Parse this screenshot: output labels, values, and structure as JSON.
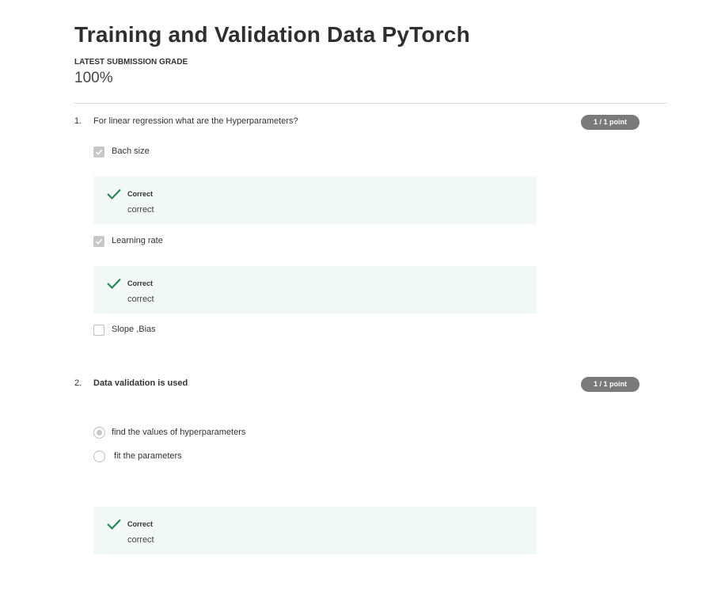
{
  "quiz": {
    "title": "Training and Validation Data PyTorch",
    "grade_label": "LATEST SUBMISSION GRADE",
    "grade_value": "100%"
  },
  "questions": [
    {
      "number": "1.",
      "text": "For linear regression what are the Hyperparameters?",
      "points": "1 / 1 point",
      "options": [
        {
          "label": "Bach size",
          "checked": true,
          "feedback": {
            "title": "Correct",
            "text": "correct"
          }
        },
        {
          "label": "Learning rate",
          "checked": true,
          "feedback": {
            "title": "Correct",
            "text": "correct"
          }
        },
        {
          "label": "Slope ,Bias",
          "checked": false
        }
      ]
    },
    {
      "number": "2.",
      "text": "Data validation  is used",
      "points": "1 / 1 point",
      "options": [
        {
          "label": "find the values of hyperparameters",
          "selected": true
        },
        {
          "label": " fit the parameters",
          "selected": false
        }
      ],
      "feedback": {
        "title": "Correct",
        "text": "correct"
      }
    }
  ],
  "colors": {
    "feedback_bg": "#f1f8f5",
    "check_green": "#1f8354",
    "points_badge": "#7a7a7a"
  }
}
